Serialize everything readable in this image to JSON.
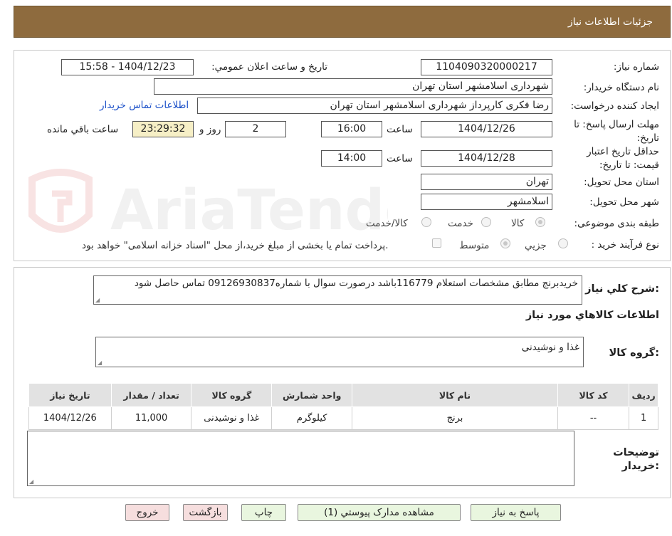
{
  "header": {
    "title": "جزئیات اطلاعات نیاز"
  },
  "form": {
    "need_number_label": "شماره نیاز:",
    "need_number": "1104090320000217",
    "announce_label": "تاریخ و ساعت اعلان عمومي:",
    "announce_value": "1404/12/23 - 15:58",
    "buyer_org_label": "نام دستگاه خريدار:",
    "buyer_org": "شهرداری اسلامشهر استان تهران",
    "creator_label": "ايجاد کننده درخواست:",
    "creator": "رضا فکری کارپرداز شهرداری اسلامشهر استان تهران",
    "contact_link": "اطلاعات تماس خريدار",
    "deadline_label": "مهلت ارسال پاسخ: تا تاریخ:",
    "deadline_date": "1404/12/26",
    "time_label": "ساعت",
    "deadline_time": "16:00",
    "days_value": "2",
    "days_label": "روز و",
    "remaining_time": "23:29:32",
    "remaining_label": "ساعت باقي مانده",
    "validity_label": "حداقل تاريخ اعتبار قيمت: تا تاريخ:",
    "validity_date": "1404/12/28",
    "validity_time": "14:00",
    "province_label": "استان محل تحويل:",
    "province": "تهران",
    "city_label": "شهر محل تحويل:",
    "city": "اسلامشهر",
    "category_label": "طبقه بندی موضوعی:",
    "category_options": [
      "کالا",
      "خدمت",
      "کالا/خدمت"
    ],
    "process_label": "نوع فرآيند خريد :",
    "process_options": [
      "جزيي",
      "متوسط"
    ],
    "payment_note": "پرداخت تمام يا بخشی از مبلغ خريد،از محل \"اسناد خزانه اسلامی\" خواهد بود."
  },
  "description": {
    "label": "شرح کلي نياز:",
    "text": "خریدبرنج مطابق مشخصات استعلام 116779باشد درصورت سوال با شماره09126930837 تماس حاصل شود"
  },
  "goods": {
    "section_title": "اطلاعات کالاهاي مورد نياز",
    "group_label": "گروه کالا:",
    "group_value": "غذا و نوشیدنی"
  },
  "table": {
    "headers": [
      "رديف",
      "کد کالا",
      "نام کالا",
      "واحد شمارش",
      "گروه کالا",
      "تعداد / مقدار",
      "تاریخ نیاز"
    ],
    "rows": [
      [
        "1",
        "--",
        "برنج",
        "کیلوگرم",
        "غذا و نوشیدنی",
        "11,000",
        "1404/12/26"
      ]
    ]
  },
  "buyer_notes": {
    "label_line1": "توضيحات",
    "label_line2": "خريدار:"
  },
  "buttons": {
    "reply": "پاسخ به نياز",
    "attachments": "مشاهده مدارک پيوستي (1)",
    "print": "چاپ",
    "back": "بازگشت",
    "exit": "خروج"
  },
  "watermark": {
    "text": "AriaTender.neT"
  },
  "colors": {
    "header_bg": "#8e6b3e",
    "link": "#1a4fc8",
    "highlight": "#f6efc6"
  }
}
